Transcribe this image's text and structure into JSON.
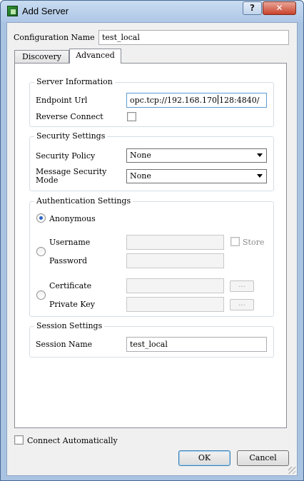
{
  "window": {
    "title": "Add Server",
    "help_symbol": "?",
    "close_symbol": "✕"
  },
  "config": {
    "label": "Configuration Name",
    "value": "test_local"
  },
  "tabs": [
    {
      "label": "Discovery",
      "active": false
    },
    {
      "label": "Advanced",
      "active": true
    }
  ],
  "server_info": {
    "title": "Server Information",
    "endpoint_label": "Endpoint Url",
    "endpoint_value_before_caret": "opc.tcp://192.168.170",
    "endpoint_value_after_caret": "128:4840/",
    "reverse_label": "Reverse Connect",
    "reverse_checked": false
  },
  "security": {
    "title": "Security Settings",
    "policy_label": "Security Policy",
    "policy_value": "None",
    "mode_label_line1": "Message Security",
    "mode_label_line2": "Mode",
    "mode_value": "None"
  },
  "auth": {
    "title": "Authentication Settings",
    "anonymous_label": "Anonymous",
    "username_label": "Username",
    "password_label": "Password",
    "store_label": "Store",
    "certificate_label": "Certificate",
    "private_key_label": "Private Key",
    "browse_label": "..."
  },
  "session": {
    "title": "Session Settings",
    "name_label": "Session Name",
    "name_value": "test_local"
  },
  "footer": {
    "connect_auto_label": "Connect Automatically",
    "ok_label": "OK",
    "cancel_label": "Cancel"
  }
}
